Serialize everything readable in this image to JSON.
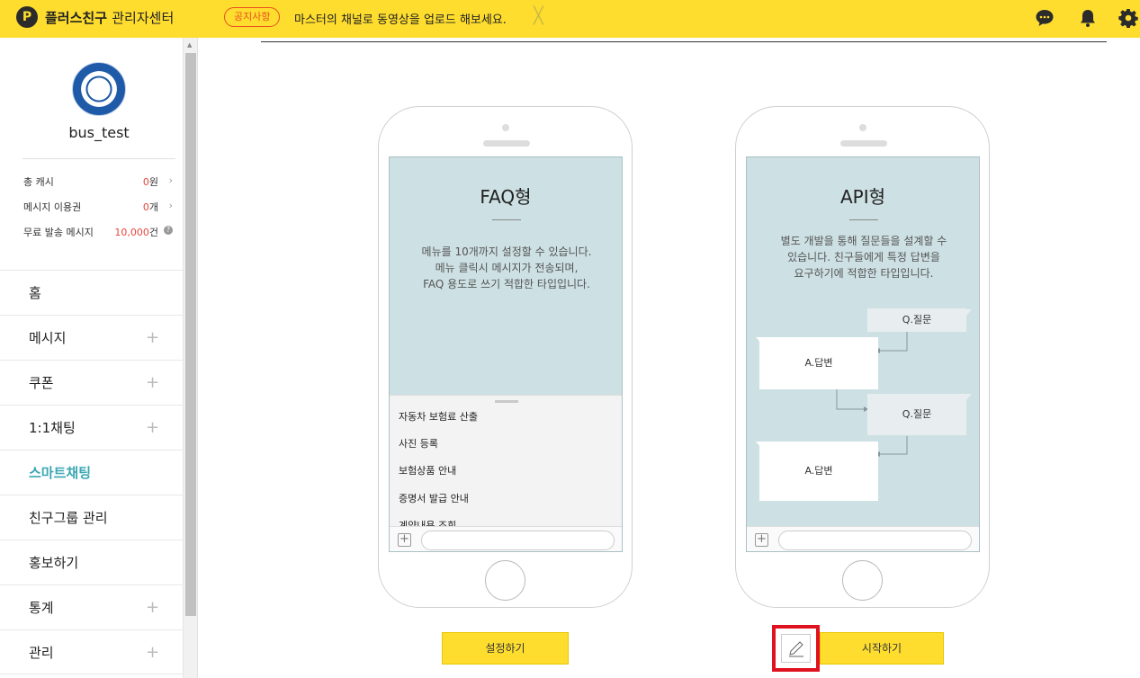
{
  "header": {
    "logo_mark": "P",
    "title_bold": "플러스친구",
    "title_light": "관리자센터",
    "notice_badge": "공지사항",
    "notice_text": "마스터의 채널로 동영상을 업로드 해보세요.",
    "close_glyph": "╳",
    "icons": [
      "chat-icon",
      "bell-icon",
      "gear-icon"
    ],
    "accent_color": "#fedd2f"
  },
  "sidebar": {
    "username": "bus_test",
    "stats": [
      {
        "label": "총 캐시",
        "value": "0",
        "unit": "원"
      },
      {
        "label": "메시지 이용권",
        "value": "0",
        "unit": "개"
      },
      {
        "label": "무료 발송 메시지",
        "value": "10,000",
        "unit": "건"
      }
    ],
    "help_glyph": "?",
    "chevron_glyph": "›",
    "plus_glyph": "+",
    "items": [
      {
        "label": "홈"
      },
      {
        "label": "메시지"
      },
      {
        "label": "쿠폰"
      },
      {
        "label": "1:1채팅"
      },
      {
        "label": "스마트채팅"
      },
      {
        "label": "친구그룹 관리"
      },
      {
        "label": "홍보하기"
      },
      {
        "label": "통계"
      },
      {
        "label": "관리"
      }
    ]
  },
  "faq_card": {
    "title": "FAQ형",
    "desc": [
      "메뉴를 10개까지 설정할 수 있습니다.",
      "메뉴 클릭시 메시지가 전송되며,",
      "FAQ 용도로 쓰기 적합한 타입입니다."
    ],
    "menu_items": [
      "자동차 보험료 산출",
      "사진 등록",
      "보험상품 안내",
      "증명서 발급 안내",
      "계약내용 조회"
    ],
    "button": "설정하기"
  },
  "api_card": {
    "title": "API형",
    "desc": [
      "별도 개발을 통해 질문들을 설계할 수",
      "있습니다. 친구들에게 특정 답변을",
      "요구하기에 적합한 타입입니다."
    ],
    "question_label": "Q.질문",
    "answer_label": "A.답변",
    "button": "시작하기"
  },
  "input_plus_glyph": "+"
}
